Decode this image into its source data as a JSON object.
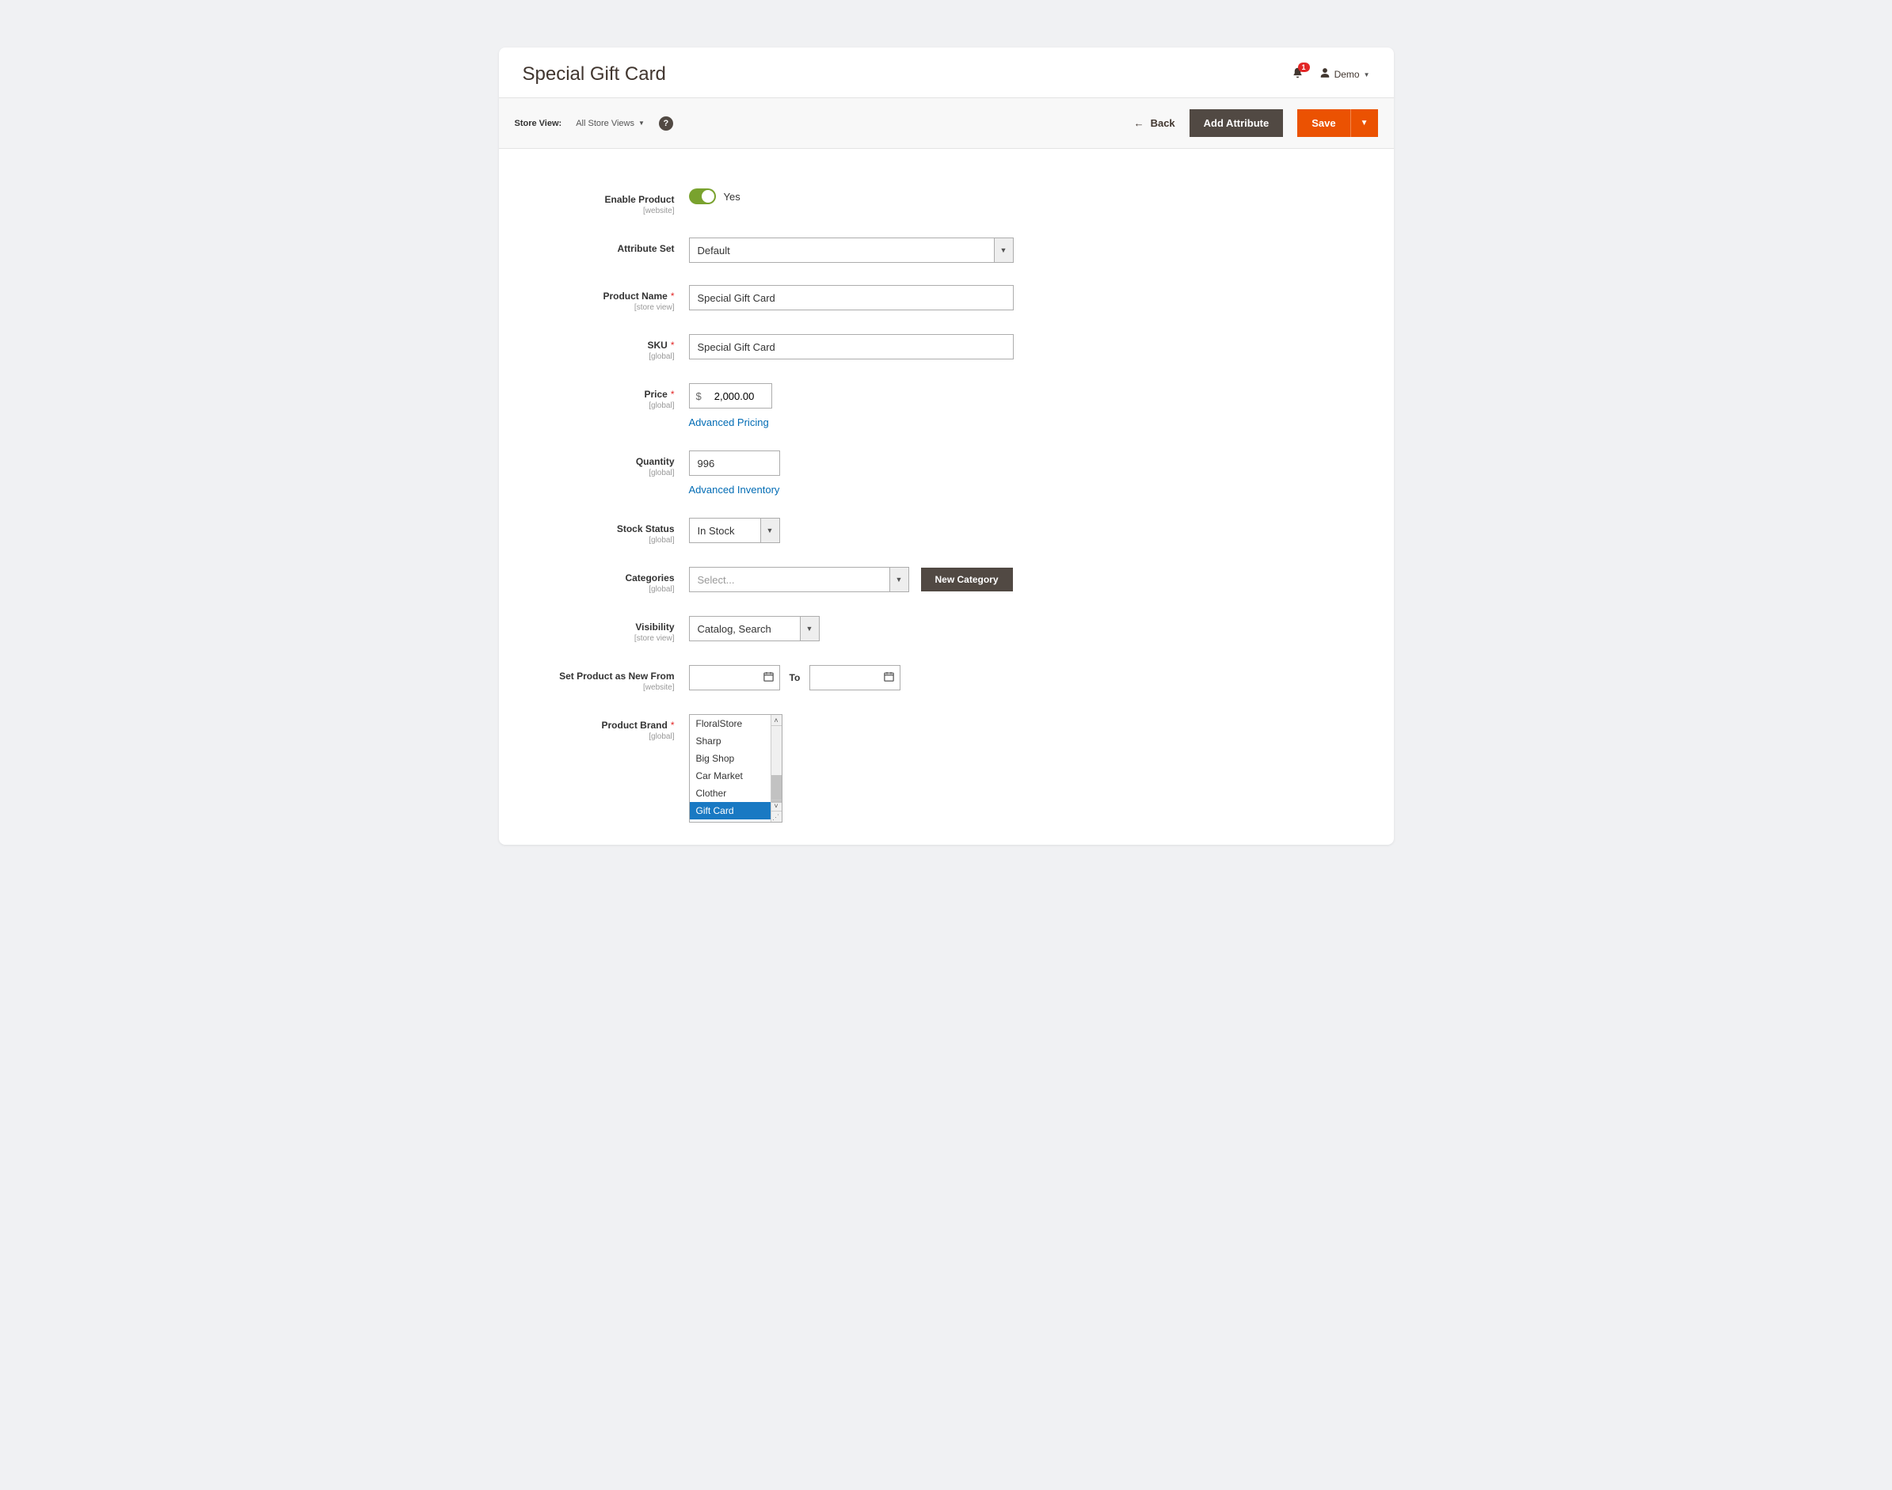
{
  "header": {
    "title": "Special Gift Card",
    "notification_count": "1",
    "user_name": "Demo"
  },
  "toolbar": {
    "store_view_label": "Store View:",
    "store_view_value": "All Store Views",
    "back_label": "Back",
    "add_attribute_label": "Add Attribute",
    "save_label": "Save"
  },
  "form": {
    "enable_product": {
      "label": "Enable Product",
      "scope": "[website]",
      "value_label": "Yes"
    },
    "attribute_set": {
      "label": "Attribute Set",
      "value": "Default"
    },
    "product_name": {
      "label": "Product Name",
      "scope": "[store view]",
      "value": "Special Gift Card"
    },
    "sku": {
      "label": "SKU",
      "scope": "[global]",
      "value": "Special Gift Card"
    },
    "price": {
      "label": "Price",
      "scope": "[global]",
      "currency": "$",
      "value": "2,000.00",
      "advanced_link": "Advanced Pricing"
    },
    "quantity": {
      "label": "Quantity",
      "scope": "[global]",
      "value": "996",
      "advanced_link": "Advanced Inventory"
    },
    "stock_status": {
      "label": "Stock Status",
      "scope": "[global]",
      "value": "In Stock"
    },
    "categories": {
      "label": "Categories",
      "scope": "[global]",
      "placeholder": "Select...",
      "new_button": "New Category"
    },
    "visibility": {
      "label": "Visibility",
      "scope": "[store view]",
      "value": "Catalog, Search"
    },
    "set_new": {
      "label": "Set Product as New From",
      "scope": "[website]",
      "to_label": "To"
    },
    "product_brand": {
      "label": "Product Brand",
      "scope": "[global]",
      "options": [
        "FloralStore",
        "Sharp",
        "Big Shop",
        "Car Market",
        "Clother",
        "Gift Card"
      ],
      "selected": "Gift Card"
    }
  }
}
